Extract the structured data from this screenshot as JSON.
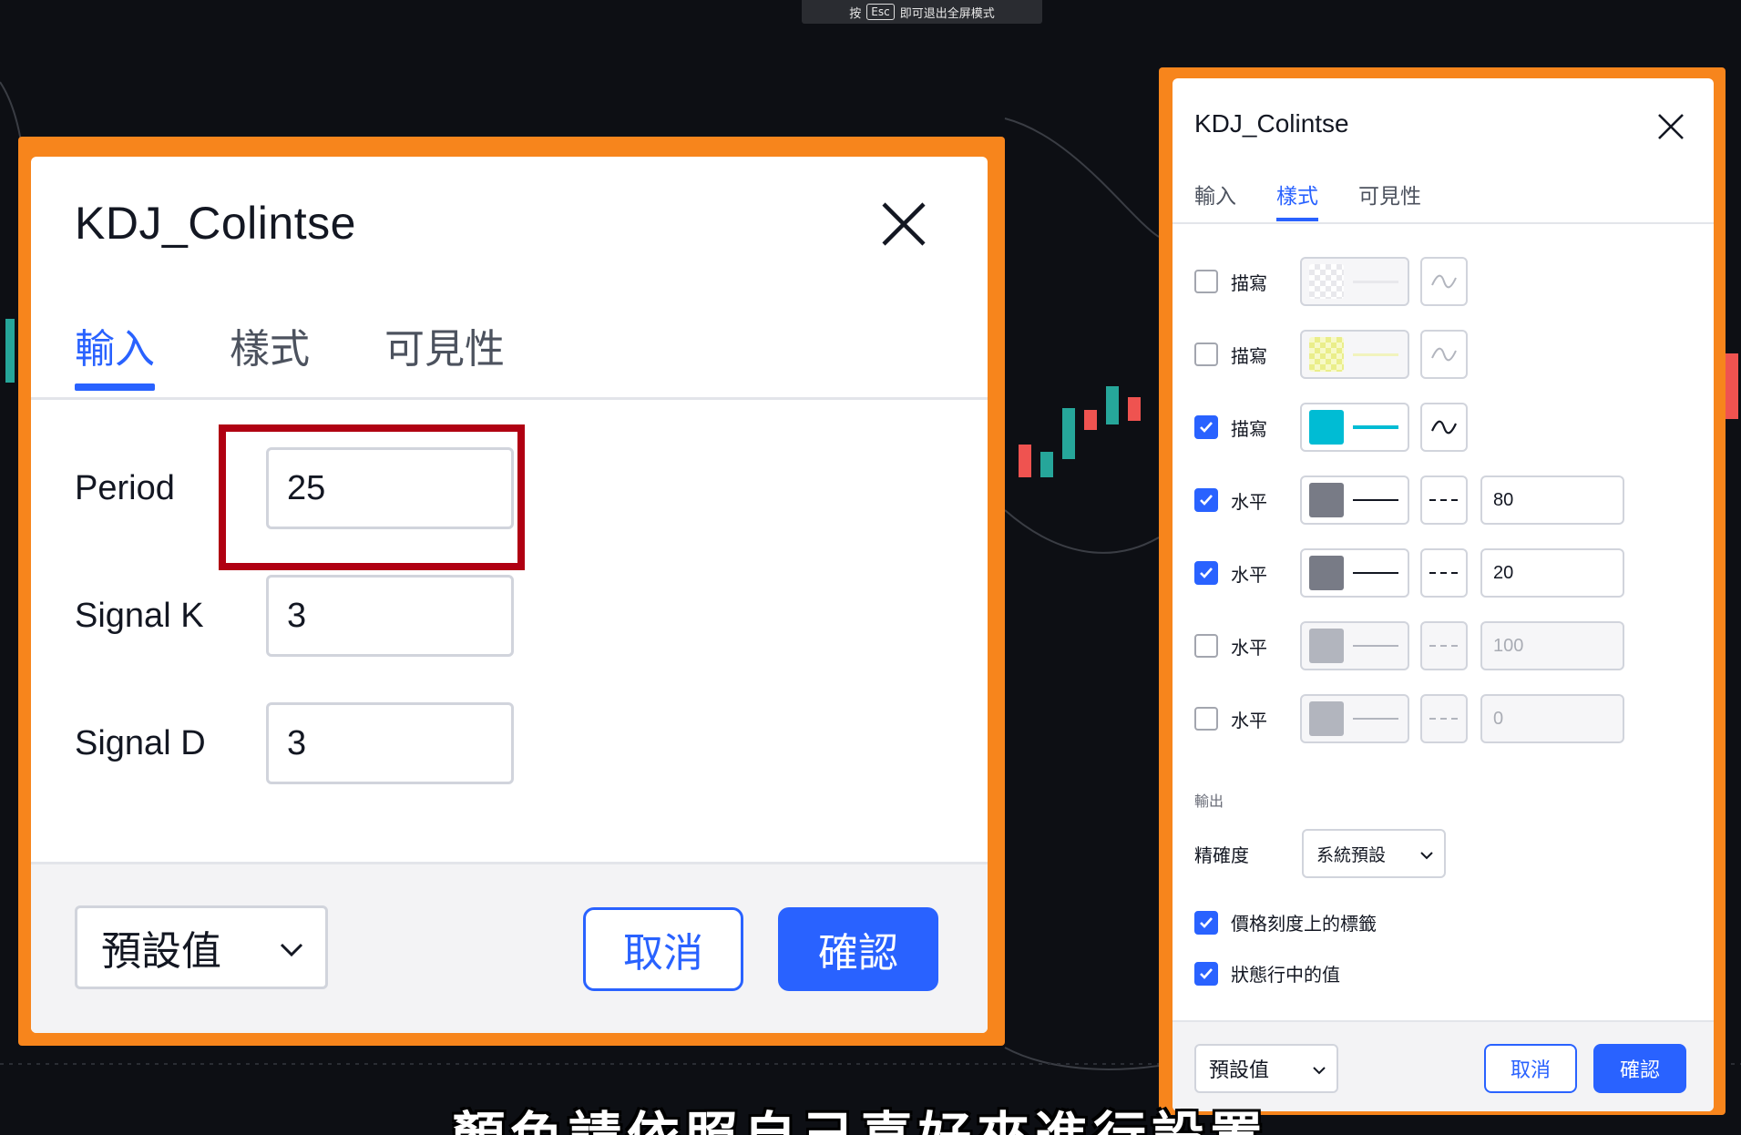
{
  "esc_hint": {
    "prefix": "按",
    "key": "Esc",
    "suffix": "即可退出全屏模式"
  },
  "zoomed_dialog": {
    "title": "KDJ_Colintse",
    "tabs": [
      {
        "label": "輸入",
        "active": true
      },
      {
        "label": "樣式",
        "active": false
      },
      {
        "label": "可見性",
        "active": false
      }
    ],
    "inputs": [
      {
        "label": "Period",
        "value": "25",
        "highlighted": true
      },
      {
        "label": "Signal K",
        "value": "3"
      },
      {
        "label": "Signal D",
        "value": "3"
      }
    ],
    "preset_label": "預設值",
    "cancel_label": "取消",
    "ok_label": "確認"
  },
  "style_dialog": {
    "title": "KDJ_Colintse",
    "tabs": [
      {
        "label": "輸入",
        "active": false
      },
      {
        "label": "樣式",
        "active": true
      },
      {
        "label": "可見性",
        "active": false
      }
    ],
    "plots": [
      {
        "label": "描寫",
        "checked": false,
        "color": "#e8e8ec"
      },
      {
        "label": "描寫",
        "checked": false,
        "color": "#eaee8a"
      },
      {
        "label": "描寫",
        "checked": true,
        "color": "#00bcd4"
      }
    ],
    "levels": [
      {
        "label": "水平",
        "checked": true,
        "value": "80",
        "color": "#787b86"
      },
      {
        "label": "水平",
        "checked": true,
        "value": "20",
        "color": "#787b86"
      },
      {
        "label": "水平",
        "checked": false,
        "value": "100",
        "color": "#b2b5be"
      },
      {
        "label": "水平",
        "checked": false,
        "value": "0",
        "color": "#b2b5be"
      }
    ],
    "output_section": "輸出",
    "precision_label": "精確度",
    "precision_value": "系統預設",
    "checkbox_price_scale": "價格刻度上的標籤",
    "checkbox_status_line": "狀態行中的值",
    "preset_label": "預設值",
    "cancel_label": "取消",
    "ok_label": "確認"
  },
  "subtitle": "顏色請依照自己喜好來進行設置",
  "colors": {
    "accent": "#2962ff",
    "frame": "#f7851c",
    "highlight": "#b00012"
  }
}
